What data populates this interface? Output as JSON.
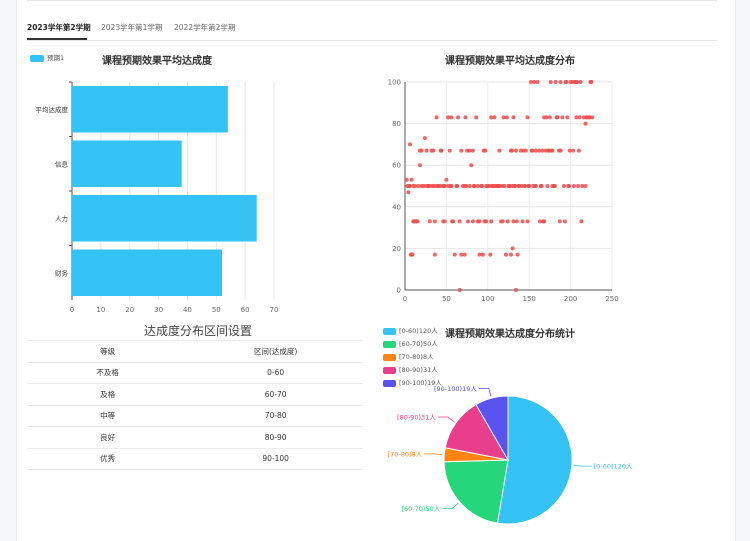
{
  "tabs": [
    "2023学年第2学期",
    "2023学年第1学期",
    "2022学年第2学期"
  ],
  "bar_chart_title": "课程预期效果平均达成度",
  "scatter_title": "课程预期效果平均达成度分布",
  "table_title": "达成度分布区间设置",
  "pie_title": "课程预期效果达成度分布统计",
  "grade_table": {
    "headers": [
      "等级",
      "区间(达成度)"
    ],
    "rows": [
      [
        "不及格",
        "0-60"
      ],
      [
        "及格",
        "60-70"
      ],
      [
        "中等",
        "70-80"
      ],
      [
        "良好",
        "80-90"
      ],
      [
        "优秀",
        "90-100"
      ]
    ]
  },
  "colors": {
    "bar": "#35c3f5",
    "scatter": "#ee4b4b",
    "pie": [
      "#35c3f5",
      "#25d67a",
      "#ff8412",
      "#e83e8c",
      "#5b52f0"
    ]
  },
  "chart_data": [
    {
      "type": "bar",
      "orientation": "horizontal",
      "title": "课程预期效果平均达成度",
      "categories": [
        "平均达成度",
        "信息",
        "人力",
        "财务"
      ],
      "series": [
        {
          "name": "预期1",
          "values": [
            54,
            38,
            64,
            52
          ]
        }
      ],
      "xlim": [
        0,
        70
      ],
      "xticks": [
        0,
        10,
        20,
        30,
        40,
        50,
        60,
        70
      ],
      "grid": true,
      "legend": "top-left"
    },
    {
      "type": "scatter",
      "title": "课程预期效果平均达成度分布",
      "xlim": [
        0,
        250
      ],
      "ylim": [
        0,
        100
      ],
      "xticks": [
        0,
        50,
        100,
        150,
        200,
        250
      ],
      "yticks": [
        0,
        20,
        40,
        60,
        80,
        100
      ],
      "grid": true,
      "x": [
        2,
        3,
        4,
        5,
        6,
        6,
        7,
        8,
        9,
        10,
        11,
        12,
        14,
        16,
        18,
        20,
        22,
        24,
        26,
        28,
        30,
        32,
        34,
        35,
        36,
        38,
        40,
        42,
        44,
        45,
        46,
        48,
        50,
        52,
        54,
        55,
        56,
        58,
        60,
        62,
        64,
        66,
        68,
        70,
        72,
        74,
        75,
        76,
        78,
        80,
        82,
        84,
        86,
        88,
        90,
        92,
        94,
        95,
        96,
        98,
        100,
        102,
        104,
        105,
        106,
        108,
        110,
        112,
        114,
        115,
        116,
        118,
        120,
        122,
        124,
        125,
        126,
        128,
        130,
        132,
        134,
        135,
        136,
        138,
        140,
        142,
        144,
        145,
        146,
        148,
        150,
        152,
        154,
        155,
        156,
        158,
        160,
        162,
        164,
        165,
        166,
        168,
        170,
        172,
        174,
        175,
        176,
        178,
        180,
        182,
        184,
        186,
        188,
        190,
        192,
        194,
        195,
        196,
        198,
        200,
        202,
        204,
        205,
        206,
        208,
        210,
        212,
        214,
        216,
        218,
        220,
        222,
        224,
        225,
        8,
        12,
        15,
        20,
        25,
        30,
        33,
        38,
        43,
        47,
        52,
        57,
        63,
        68,
        73,
        78,
        83,
        88,
        93,
        98,
        103,
        108,
        113,
        118,
        123,
        128,
        131,
        133,
        137,
        143,
        148,
        153,
        158,
        163,
        168,
        173,
        178,
        183,
        188,
        193,
        197,
        203,
        207,
        213,
        218,
        223,
        10,
        18,
        28,
        36,
        48,
        56,
        66,
        72,
        82,
        90,
        97,
        104,
        112,
        119,
        127,
        134,
        141,
        149,
        157,
        167,
        171,
        177,
        181,
        187,
        199,
        209,
        211,
        219,
        226,
        129,
        131,
        130
      ],
      "y": [
        53,
        50,
        47,
        50,
        70,
        50,
        17,
        53,
        17,
        50,
        33,
        33,
        33,
        50,
        60,
        50,
        50,
        73,
        67,
        50,
        50,
        67,
        67,
        50,
        17,
        50,
        50,
        50,
        67,
        50,
        33,
        33,
        53,
        50,
        67,
        50,
        50,
        33,
        17,
        50,
        83,
        33,
        67,
        50,
        17,
        50,
        67,
        33,
        50,
        60,
        67,
        50,
        83,
        50,
        33,
        50,
        17,
        67,
        33,
        50,
        50,
        50,
        83,
        50,
        50,
        50,
        50,
        50,
        67,
        50,
        33,
        50,
        50,
        17,
        33,
        50,
        50,
        17,
        20,
        50,
        67,
        33,
        17,
        50,
        67,
        33,
        50,
        50,
        67,
        33,
        50,
        100,
        67,
        50,
        100,
        67,
        100,
        67,
        50,
        50,
        67,
        33,
        67,
        50,
        67,
        83,
        100,
        67,
        50,
        100,
        83,
        67,
        100,
        83,
        50,
        100,
        100,
        83,
        50,
        100,
        100,
        50,
        100,
        100,
        100,
        67,
        100,
        50,
        83,
        80,
        83,
        83,
        100,
        100,
        17,
        50,
        33,
        67,
        50,
        33,
        50,
        83,
        67,
        50,
        83,
        33,
        50,
        17,
        83,
        67,
        50,
        33,
        50,
        33,
        17,
        83,
        50,
        33,
        83,
        67,
        33,
        50,
        50,
        67,
        83,
        67,
        50,
        33,
        83,
        67,
        50,
        83,
        67,
        33,
        50,
        67,
        83,
        33,
        50,
        83,
        33,
        67,
        50,
        33,
        50,
        83,
        0,
        50,
        33,
        17,
        67,
        33,
        50,
        83,
        50,
        0,
        50,
        50,
        50,
        33,
        83,
        67,
        50,
        33,
        67,
        50,
        83,
        83,
        83,
        67,
        83,
        50,
        83,
        40,
        67,
        23,
        27
      ]
    },
    {
      "type": "pie",
      "title": "课程预期效果达成度分布统计",
      "categories": [
        "[0-60)120人",
        "[60-70)50人",
        "[70-80)8人",
        "[80-90)31人",
        "[90-100)19人"
      ],
      "values": [
        120,
        50,
        8,
        31,
        19
      ],
      "legend": "top-left"
    }
  ]
}
